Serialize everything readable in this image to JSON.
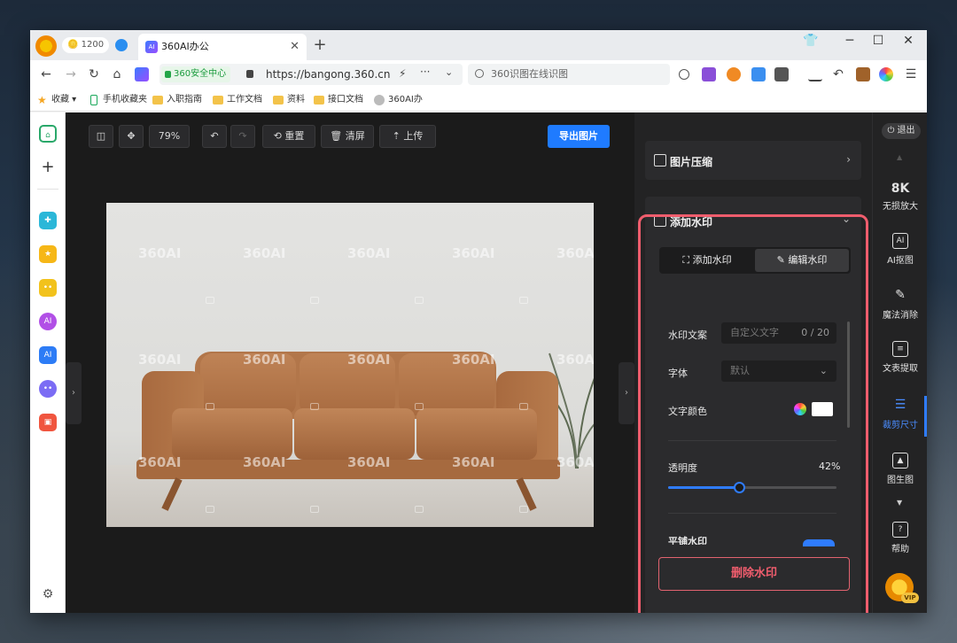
{
  "browser": {
    "coin_count": "1200",
    "tab_title": "360AI办公",
    "secure_label": "360安全中心",
    "url": "https://bangong.360.cn",
    "search_placeholder": "360识图在线识图",
    "bookmarks": [
      "收藏",
      "手机收藏夹",
      "入职指南",
      "工作文档",
      "资料",
      "接口文档",
      "360AI办"
    ]
  },
  "toolbar": {
    "zoom": "79%",
    "reset_label": "重置",
    "clear_label": "清屏",
    "upload_label": "上传",
    "export_label": "导出图片"
  },
  "watermark_text": "360AI",
  "panel": {
    "compress_title": "图片压缩",
    "watermark_title": "添加水印",
    "tab_add": "添加水印",
    "tab_edit": "编辑水印",
    "text_label": "水印文案",
    "text_placeholder": "自定义文字",
    "text_count": "0 / 20",
    "font_label": "字体",
    "font_value": "默认",
    "color_label": "文字颜色",
    "text_color": "#ffffff",
    "opacity_label": "透明度",
    "opacity_value": "42%",
    "opacity_fraction": 0.42,
    "tile_label": "平铺水印",
    "delete_label": "删除水印"
  },
  "rightbar": {
    "logout": "退出",
    "items": [
      {
        "top": "8K",
        "label": "无损放大"
      },
      {
        "top": "AI",
        "label": "AI抠图"
      },
      {
        "top": "",
        "label": "魔法消除"
      },
      {
        "top": "",
        "label": "文表提取"
      },
      {
        "top": "",
        "label": "裁剪尺寸"
      },
      {
        "top": "",
        "label": "图生图"
      },
      {
        "top": "?",
        "label": "帮助"
      }
    ],
    "vip": "VIP"
  },
  "accent_color": "#1f7bff",
  "highlight_color": "#ef5d6d"
}
